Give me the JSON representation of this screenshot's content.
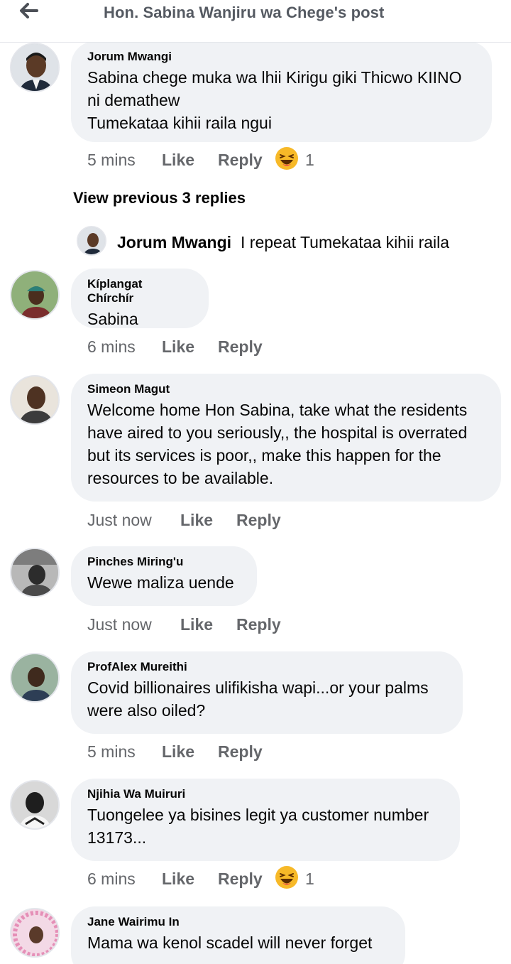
{
  "header": {
    "title": "Hon. Sabina Wanjiru wa Chege's post"
  },
  "labels": {
    "like": "Like",
    "reply": "Reply"
  },
  "view_previous": "View previous 3 replies",
  "reply": {
    "author": "Jorum Mwangi",
    "text": "I repeat Tumekataa kihii raila"
  },
  "comments": [
    {
      "author": "Jorum Mwangi",
      "lines": [
        "Sabina chege muka wa lhii Kirigu giki Thicwo KIINO",
        "ni demathew",
        "Tumekataa kihii raila ngui"
      ],
      "time": "5 mins",
      "reaction": {
        "icon": "haha-emoji-icon",
        "count": "1"
      }
    },
    {
      "author": "Kíplangat Chírchír",
      "lines": [
        "Sabina"
      ],
      "time": "6 mins"
    },
    {
      "author": "Simeon Magut",
      "lines": [
        "Welcome home Hon Sabina, take what the residents",
        "have aired to you seriously,, the hospital is overrated",
        "but its services is poor,, make this happen for the",
        "resources to be available."
      ],
      "time": "Just now"
    },
    {
      "author": "Pinches Miring'u",
      "lines": [
        "Wewe maliza uende"
      ],
      "time": "Just now"
    },
    {
      "author": "ProfAlex Mureithi",
      "lines": [
        "Covid billionaires ulifikisha wapi...or your palms",
        "were also oiled?"
      ],
      "time": "5 mins"
    },
    {
      "author": "Njihia Wa Muiruri",
      "lines": [
        "Tuongelee ya bisines legit ya customer number",
        "13173..."
      ],
      "time": "6 mins",
      "reaction": {
        "icon": "haha-emoji-icon",
        "count": "1"
      }
    },
    {
      "author": "Jane Wairimu In",
      "lines": [
        "Mama wa kenol scadel will never forget"
      ]
    }
  ],
  "colors": {
    "bubble": "#f0f2f5",
    "meta_text": "#65676b",
    "haha_yellow": "#f7b928"
  }
}
